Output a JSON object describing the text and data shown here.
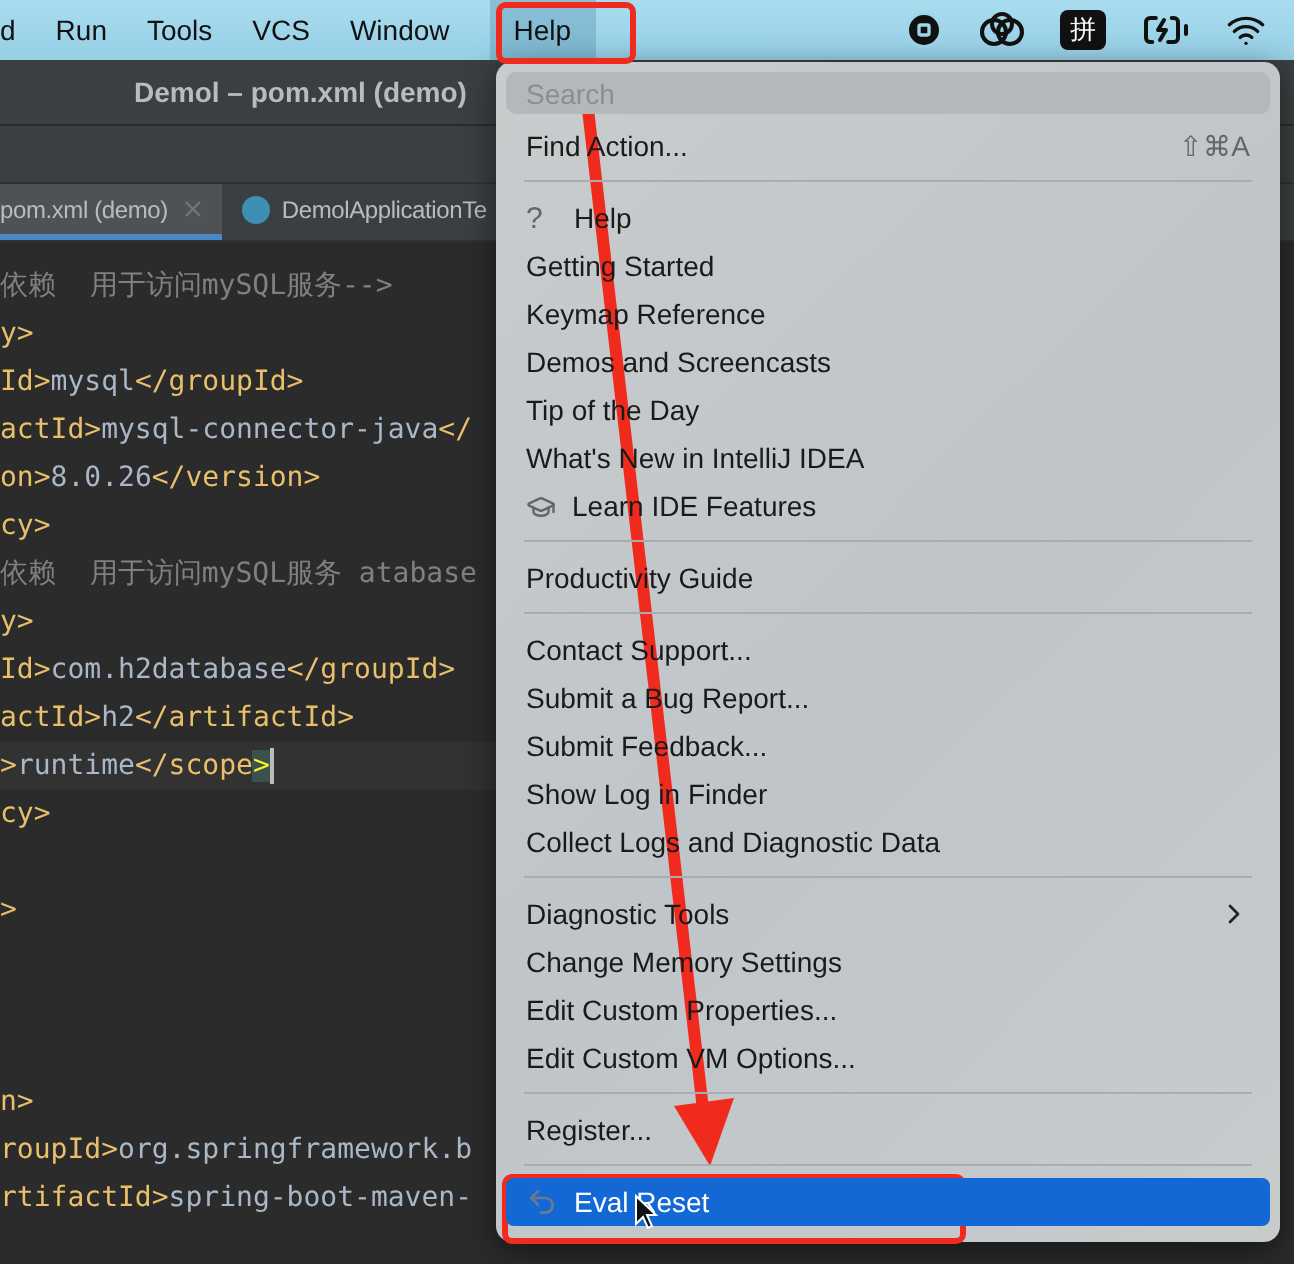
{
  "menu_bar": {
    "items": [
      {
        "label": "d",
        "selected": false
      },
      {
        "label": "Run",
        "selected": false
      },
      {
        "label": "Tools",
        "selected": false
      },
      {
        "label": "VCS",
        "selected": false
      },
      {
        "label": "Window",
        "selected": false
      },
      {
        "label": "Help",
        "selected": true
      }
    ],
    "input_method": "拼"
  },
  "window": {
    "title": "Demol – pom.xml (demo)"
  },
  "tabs": [
    {
      "label": "pom.xml (demo)",
      "selected": true,
      "kind": "xml"
    },
    {
      "label": "DemolApplicationTe",
      "selected": false,
      "kind": "class"
    }
  ],
  "editor": {
    "lines": [
      {
        "current": false,
        "segments": [
          {
            "kind": "comment",
            "text": "依赖  用于访问mySQL服务-->"
          }
        ]
      },
      {
        "current": false,
        "segments": [
          {
            "kind": "tag",
            "text": "y>"
          }
        ]
      },
      {
        "current": false,
        "segments": [
          {
            "kind": "tag",
            "text": "Id>"
          },
          {
            "kind": "text",
            "text": "mysql"
          },
          {
            "kind": "tag",
            "text": "</groupId>"
          }
        ]
      },
      {
        "current": false,
        "segments": [
          {
            "kind": "tag",
            "text": "actId>"
          },
          {
            "kind": "text",
            "text": "mysql-connector-java"
          },
          {
            "kind": "tag",
            "text": "</"
          }
        ]
      },
      {
        "current": false,
        "segments": [
          {
            "kind": "tag",
            "text": "on>"
          },
          {
            "kind": "text",
            "text": "8.0.26"
          },
          {
            "kind": "tag",
            "text": "</version>"
          }
        ]
      },
      {
        "current": false,
        "segments": [
          {
            "kind": "tag",
            "text": "cy>"
          }
        ]
      },
      {
        "current": false,
        "segments": [
          {
            "kind": "comment",
            "text": "依赖  用于访问mySQL服务 atabase"
          }
        ]
      },
      {
        "current": false,
        "segments": [
          {
            "kind": "tag",
            "text": "y>"
          }
        ]
      },
      {
        "current": false,
        "segments": [
          {
            "kind": "tag",
            "text": "Id>"
          },
          {
            "kind": "text",
            "text": "com.h2database"
          },
          {
            "kind": "tag",
            "text": "</groupId>"
          }
        ]
      },
      {
        "current": false,
        "segments": [
          {
            "kind": "tag",
            "text": "actId>"
          },
          {
            "kind": "text",
            "text": "h2"
          },
          {
            "kind": "tag",
            "text": "</artifactId>"
          }
        ]
      },
      {
        "current": true,
        "segments": [
          {
            "kind": "tag",
            "text": ">"
          },
          {
            "kind": "text",
            "text": "runtime"
          },
          {
            "kind": "tag",
            "text": "</scope"
          },
          {
            "kind": "match",
            "text": ">"
          }
        ]
      },
      {
        "current": false,
        "segments": [
          {
            "kind": "tag",
            "text": "cy>"
          }
        ]
      },
      {
        "current": false
      },
      {
        "current": false,
        "segments": [
          {
            "kind": "tag",
            "text": ">"
          }
        ]
      },
      {
        "current": false
      },
      {
        "current": false
      },
      {
        "current": false
      },
      {
        "current": false,
        "segments": [
          {
            "kind": "tag",
            "text": "n>"
          }
        ]
      },
      {
        "current": false,
        "segments": [
          {
            "kind": "tag",
            "text": "roupId>"
          },
          {
            "kind": "text",
            "text": "org.springframework.b"
          }
        ]
      },
      {
        "current": false,
        "segments": [
          {
            "kind": "tag",
            "text": "rtifactId>"
          },
          {
            "kind": "text",
            "text": "spring-boot-maven-"
          }
        ]
      }
    ]
  },
  "help_menu": {
    "search": {
      "placeholder": "Search"
    },
    "entries": [
      {
        "kind": "item",
        "label": "Find Action...",
        "shortcut": "⇧⌘A",
        "selected": false
      },
      {
        "kind": "separator"
      },
      {
        "kind": "item",
        "glyph": "?",
        "label": "Help",
        "selected": false
      },
      {
        "kind": "item",
        "label": "Getting Started",
        "selected": false
      },
      {
        "kind": "item",
        "label": "Keymap Reference",
        "selected": false
      },
      {
        "kind": "item",
        "label": "Demos and Screencasts",
        "selected": false
      },
      {
        "kind": "item",
        "label": "Tip of the Day",
        "selected": false
      },
      {
        "kind": "item",
        "label": "What's New in IntelliJ IDEA",
        "selected": false
      },
      {
        "kind": "learn",
        "label": "Learn IDE Features",
        "selected": false
      },
      {
        "kind": "separator"
      },
      {
        "kind": "item",
        "label": "Productivity Guide",
        "selected": false
      },
      {
        "kind": "separator"
      },
      {
        "kind": "item",
        "label": "Contact Support...",
        "selected": false
      },
      {
        "kind": "item",
        "label": "Submit a Bug Report...",
        "selected": false
      },
      {
        "kind": "item",
        "label": "Submit Feedback...",
        "selected": false
      },
      {
        "kind": "item",
        "label": "Show Log in Finder",
        "selected": false
      },
      {
        "kind": "item",
        "label": "Collect Logs and Diagnostic Data",
        "selected": false
      },
      {
        "kind": "separator"
      },
      {
        "kind": "item",
        "label": "Diagnostic Tools",
        "submenu": true,
        "selected": false
      },
      {
        "kind": "item",
        "label": "Change Memory Settings",
        "selected": false
      },
      {
        "kind": "item",
        "label": "Edit Custom Properties...",
        "selected": false
      },
      {
        "kind": "item",
        "label": "Edit Custom VM Options...",
        "selected": false
      },
      {
        "kind": "separator"
      },
      {
        "kind": "item",
        "label": "Register...",
        "selected": false
      },
      {
        "kind": "separator"
      },
      {
        "kind": "reset",
        "label": "Eval Reset",
        "selected": true
      }
    ]
  }
}
